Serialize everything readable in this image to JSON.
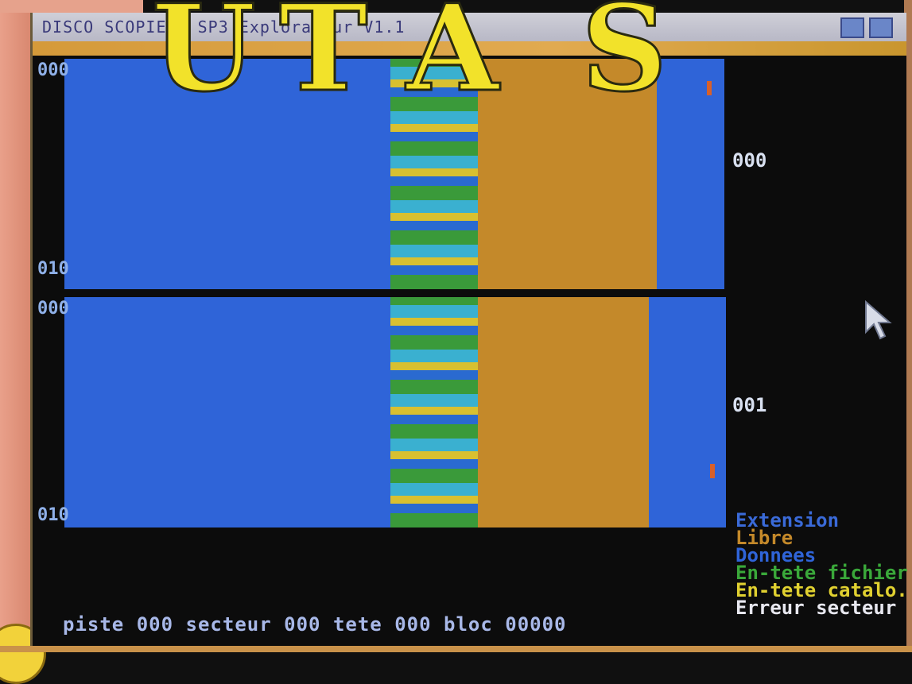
{
  "window": {
    "title": "DISCO SCOPIE  - SP3  Explorateur V1.1"
  },
  "logo": {
    "letters": [
      "U",
      "T",
      "A",
      "S"
    ]
  },
  "tracks": {
    "top": {
      "start_label": "000",
      "end_label": "010"
    },
    "bottom": {
      "start_label": "000",
      "end_label": "010"
    }
  },
  "heads": {
    "head_0": "000",
    "head_1": "001"
  },
  "legend": [
    {
      "label": "Extension",
      "color": "#3a6ad8"
    },
    {
      "label": "Libre",
      "color": "#c4892a"
    },
    {
      "label": "Donnees",
      "color": "#2f64d8"
    },
    {
      "label": "En-tete fichier",
      "color": "#3aa83a"
    },
    {
      "label": "En-tete catalo.",
      "color": "#e0d030"
    },
    {
      "label": "Erreur secteur",
      "color": "#e8e8f0"
    }
  ],
  "status": {
    "piste_label": "piste",
    "piste": "000",
    "secteur_label": "secteur",
    "secteur": "000",
    "tete_label": "tete",
    "tete": "000",
    "bloc_label": "bloc",
    "bloc": "00000"
  }
}
